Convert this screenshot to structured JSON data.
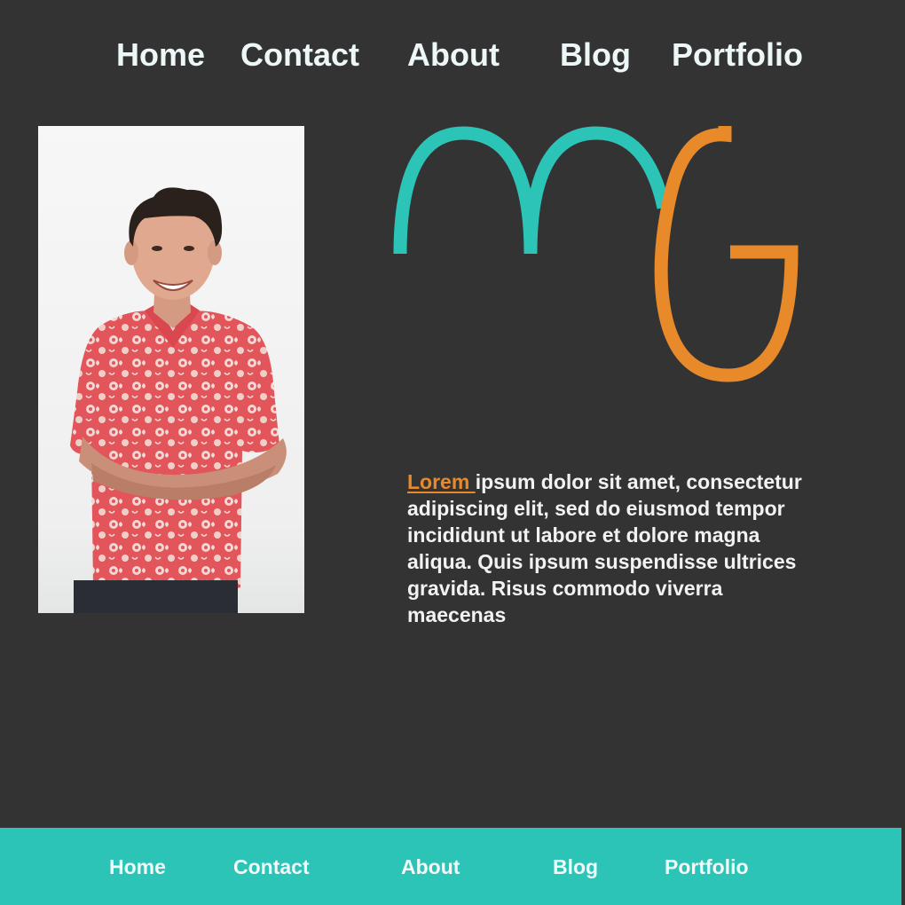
{
  "top_nav": {
    "items": [
      {
        "label": "Home"
      },
      {
        "label": "Contact"
      },
      {
        "label": "About"
      },
      {
        "label": "Blog"
      },
      {
        "label": "Portfolio"
      }
    ]
  },
  "logo": {
    "icon": "mg-monogram-logo",
    "colors": {
      "m": "#2cc4b7",
      "g": "#e8892a"
    }
  },
  "bio": {
    "highlight": "Lorem ",
    "text": "ipsum dolor sit amet, consectetur adipiscing elit, sed do eiusmod tempor incididunt ut labore et dolore magna aliqua. Quis ipsum suspendisse ultrices gravida. Risus commodo viverra maecenas"
  },
  "footer_nav": {
    "items": [
      {
        "label": "Home"
      },
      {
        "label": "Contact"
      },
      {
        "label": "About"
      },
      {
        "label": "Blog"
      },
      {
        "label": "Portfolio"
      }
    ]
  },
  "colors": {
    "background": "#333333",
    "accent_teal": "#2cc4b7",
    "accent_orange": "#e8892a"
  }
}
